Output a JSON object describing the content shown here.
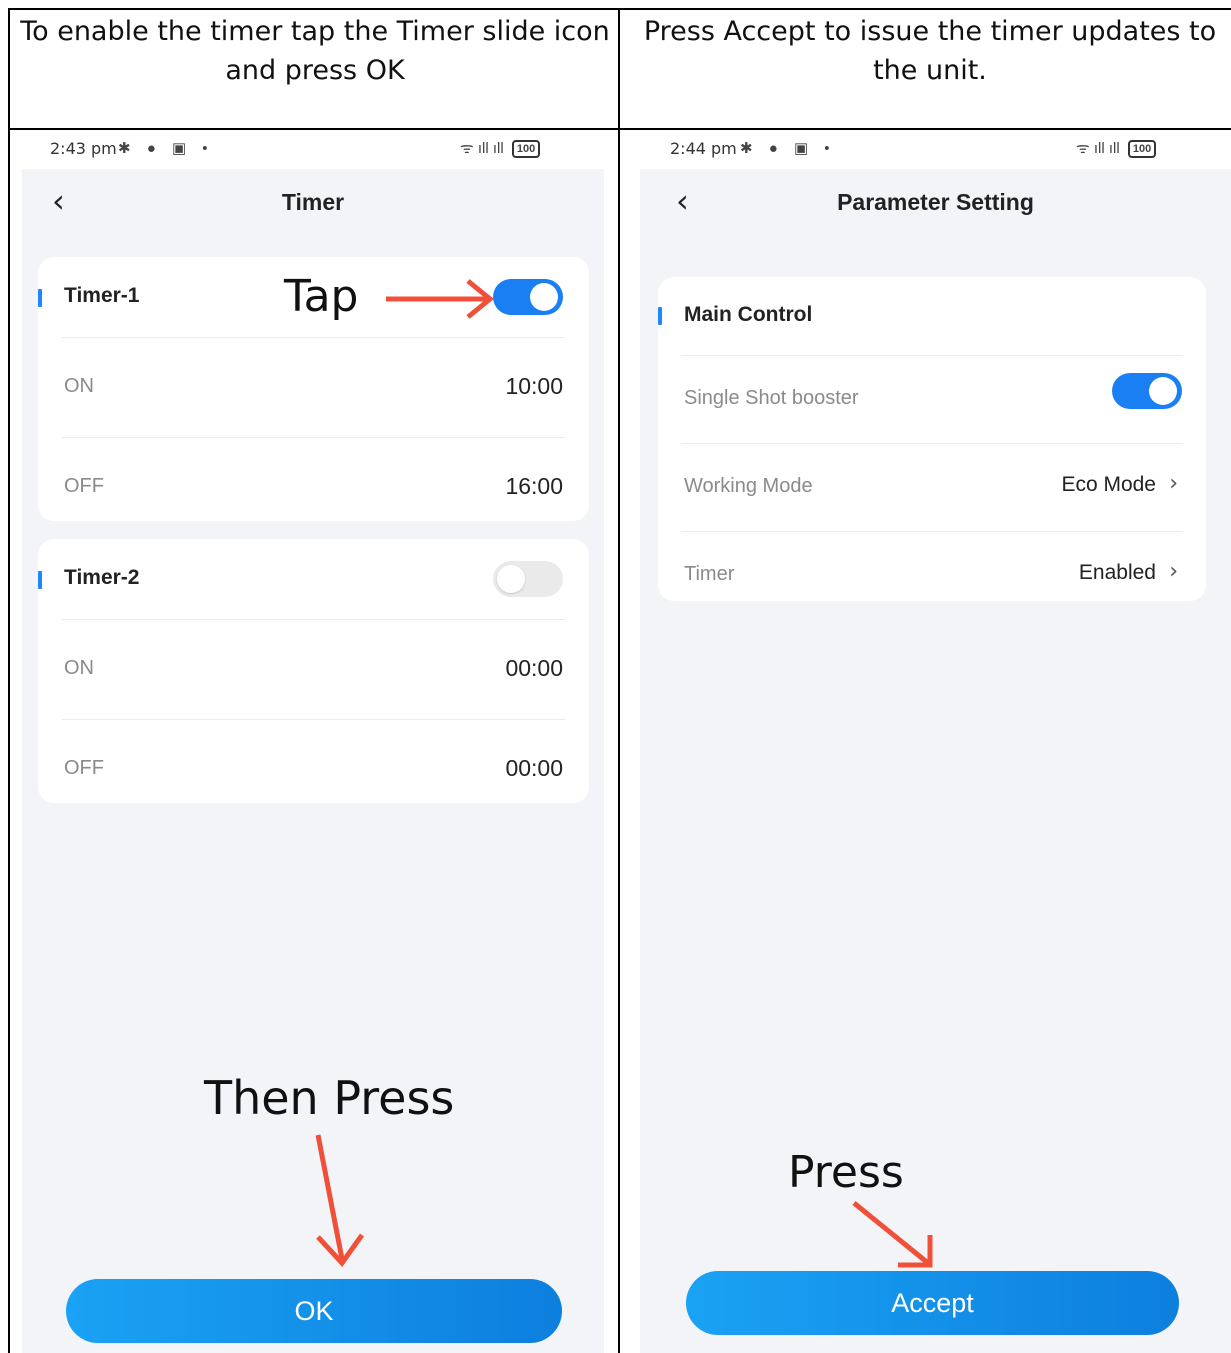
{
  "left_panel": {
    "caption": "To enable the timer tap the Timer slide icon and press OK",
    "status": {
      "time": "2:43 pm",
      "icons_left": "✱ ● ▣  •",
      "signal": "ᯤ ıll ıll",
      "battery": "100"
    },
    "title": "Timer",
    "timers": [
      {
        "name": "Timer-1",
        "enabled": true,
        "on_label": "ON",
        "on_value": "10:00",
        "off_label": "OFF",
        "off_value": "16:00"
      },
      {
        "name": "Timer-2",
        "enabled": false,
        "on_label": "ON",
        "on_value": "00:00",
        "off_label": "OFF",
        "off_value": "00:00"
      }
    ],
    "ok_label": "OK",
    "annotation_tap": "Tap",
    "annotation_then_press": "Then Press"
  },
  "right_panel": {
    "caption": "Press Accept to issue the timer updates to the unit.",
    "status": {
      "time": "2:44 pm",
      "icons_left": "✱ ● ▣  •",
      "signal": "ᯤ ıll ıll",
      "battery": "100"
    },
    "title": "Parameter Setting",
    "section": "Main Control",
    "single_shot_label": "Single Shot booster",
    "single_shot_enabled": true,
    "working_mode_label": "Working Mode",
    "working_mode_value": "Eco Mode",
    "timer_label": "Timer",
    "timer_value": "Enabled",
    "accept_label": "Accept",
    "annotation_press": "Press"
  },
  "colors": {
    "accent_blue": "#1a7ff2",
    "arrow_red": "#f0503a",
    "screen_bg": "#f3f4f8"
  }
}
